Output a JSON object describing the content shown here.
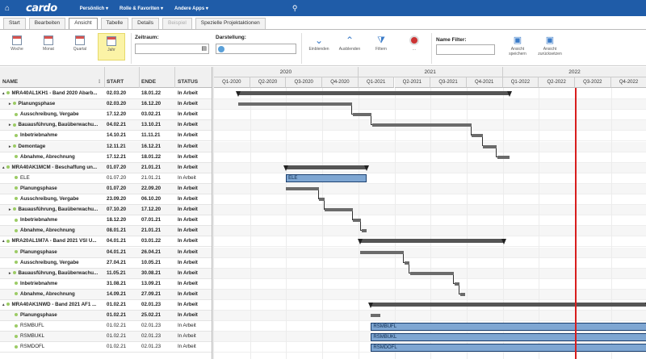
{
  "topbar": {
    "logo": "cardo",
    "menus": [
      "Persönlich",
      "Rolle & Favoriten",
      "Andere Apps"
    ]
  },
  "tabs": [
    {
      "label": "Start",
      "state": "normal"
    },
    {
      "label": "Bearbeiten",
      "state": "normal"
    },
    {
      "label": "Ansicht",
      "state": "active"
    },
    {
      "label": "Tabelle",
      "state": "normal"
    },
    {
      "label": "Details",
      "state": "normal"
    },
    {
      "label": "Beispiel",
      "state": "disabled"
    },
    {
      "label": "Spezielle Projektaktionen",
      "state": "normal"
    }
  ],
  "ribbon": {
    "view_buttons": [
      "Woche",
      "Monat",
      "Quartal",
      "Jahr"
    ],
    "selected_view": "Jahr",
    "zeitraum_label": "Zeitraum:",
    "darstellung_label": "Darstellung:",
    "action_buttons": [
      "Einblenden",
      "Ausblenden",
      "Filtern",
      "..."
    ],
    "name_filter_label": "Name Filter:",
    "save_view": "Ansicht speichern",
    "reset_view": "Ansicht zurücksetzen"
  },
  "columns": {
    "name": "NAME",
    "start": "START",
    "end": "ENDE",
    "status": "STATUS"
  },
  "timeline": {
    "years": [
      "2020",
      "2021",
      "2022"
    ],
    "quarters": [
      "Q1-2020",
      "Q2-2020",
      "Q3-2020",
      "Q4-2020",
      "Q1-2021",
      "Q2-2021",
      "Q3-2021",
      "Q4-2021",
      "Q1-2022",
      "Q2-2022",
      "Q3-2022",
      "Q4-2022",
      "Q"
    ]
  },
  "rows": [
    {
      "level": 0,
      "tri": "▴",
      "name": "MRA40AL1KH1 - Band 2020 Abarb...",
      "start": "02.03.20",
      "end": "18.01.22",
      "status": "In Arbeit",
      "bold": true,
      "bar": "sum"
    },
    {
      "level": 1,
      "tri": "▸",
      "name": "Planungsphase",
      "start": "02.03.20",
      "end": "16.12.20",
      "status": "In Arbeit",
      "bold": true,
      "bar": "task"
    },
    {
      "level": 1,
      "tri": "",
      "name": "Ausschreibung, Vergabe",
      "start": "17.12.20",
      "end": "03.02.21",
      "status": "In Arbeit",
      "bold": true,
      "bar": "task"
    },
    {
      "level": 1,
      "tri": "▸",
      "name": "Bauausführung, Bauüberwachu...",
      "start": "04.02.21",
      "end": "13.10.21",
      "status": "In Arbeit",
      "bold": true,
      "bar": "task"
    },
    {
      "level": 1,
      "tri": "",
      "name": "Inbetriebnahme",
      "start": "14.10.21",
      "end": "11.11.21",
      "status": "In Arbeit",
      "bold": true,
      "bar": "task"
    },
    {
      "level": 1,
      "tri": "▸",
      "name": "Demontage",
      "start": "12.11.21",
      "end": "16.12.21",
      "status": "In Arbeit",
      "bold": true,
      "bar": "task"
    },
    {
      "level": 1,
      "tri": "",
      "name": "Abnahme, Abrechnung",
      "start": "17.12.21",
      "end": "18.01.22",
      "status": "In Arbeit",
      "bold": true,
      "bar": "task"
    },
    {
      "level": 0,
      "tri": "▴",
      "name": "MRA40AK1MCM - Beschaffung un...",
      "start": "01.07.20",
      "end": "21.01.21",
      "status": "In Arbeit",
      "bold": true,
      "bar": "sum"
    },
    {
      "level": 1,
      "tri": "",
      "name": "ELE",
      "start": "01.07.20",
      "end": "21.01.21",
      "status": "In Arbeit",
      "bold": false,
      "bar": "blue",
      "bar_label": "ELE"
    },
    {
      "level": 1,
      "tri": "",
      "name": "Planungsphase",
      "start": "01.07.20",
      "end": "22.09.20",
      "status": "In Arbeit",
      "bold": true,
      "bar": "task"
    },
    {
      "level": 1,
      "tri": "",
      "name": "Ausschreibung, Vergabe",
      "start": "23.09.20",
      "end": "06.10.20",
      "status": "In Arbeit",
      "bold": true,
      "bar": "task"
    },
    {
      "level": 1,
      "tri": "▸",
      "name": "Bauausführung, Bauüberwachu...",
      "start": "07.10.20",
      "end": "17.12.20",
      "status": "In Arbeit",
      "bold": true,
      "bar": "task"
    },
    {
      "level": 1,
      "tri": "",
      "name": "Inbetriebnahme",
      "start": "18.12.20",
      "end": "07.01.21",
      "status": "In Arbeit",
      "bold": true,
      "bar": "task"
    },
    {
      "level": 1,
      "tri": "",
      "name": "Abnahme, Abrechnung",
      "start": "08.01.21",
      "end": "21.01.21",
      "status": "In Arbeit",
      "bold": true,
      "bar": "task"
    },
    {
      "level": 0,
      "tri": "▴",
      "name": "MRA20AL1M7A - Band 2021 VSI U...",
      "start": "04.01.21",
      "end": "03.01.22",
      "status": "In Arbeit",
      "bold": true,
      "bar": "sum"
    },
    {
      "level": 1,
      "tri": "",
      "name": "Planungsphase",
      "start": "04.01.21",
      "end": "26.04.21",
      "status": "In Arbeit",
      "bold": true,
      "bar": "task"
    },
    {
      "level": 1,
      "tri": "",
      "name": "Ausschreibung, Vergabe",
      "start": "27.04.21",
      "end": "10.05.21",
      "status": "In Arbeit",
      "bold": true,
      "bar": "task"
    },
    {
      "level": 1,
      "tri": "▸",
      "name": "Bauausführung, Bauüberwachu...",
      "start": "11.05.21",
      "end": "30.08.21",
      "status": "In Arbeit",
      "bold": true,
      "bar": "task"
    },
    {
      "level": 1,
      "tri": "",
      "name": "Inbetriebnahme",
      "start": "31.08.21",
      "end": "13.09.21",
      "status": "In Arbeit",
      "bold": true,
      "bar": "task"
    },
    {
      "level": 1,
      "tri": "",
      "name": "Abnahme, Abrechnung",
      "start": "14.09.21",
      "end": "27.09.21",
      "status": "In Arbeit",
      "bold": true,
      "bar": "task"
    },
    {
      "level": 0,
      "tri": "▴",
      "name": "MRA40AK1NWD - Band 2021 AF1 ...",
      "start": "01.02.21",
      "end": "02.01.23",
      "status": "In Arbeit",
      "bold": true,
      "bar": "sum"
    },
    {
      "level": 1,
      "tri": "",
      "name": "Planungsphase",
      "start": "01.02.21",
      "end": "25.02.21",
      "status": "In Arbeit",
      "bold": true,
      "bar": "task"
    },
    {
      "level": 1,
      "tri": "",
      "name": "RSMBUFL",
      "start": "01.02.21",
      "end": "02.01.23",
      "status": "In Arbeit",
      "bold": false,
      "bar": "blue",
      "bar_label": "RSMBUFL"
    },
    {
      "level": 1,
      "tri": "",
      "name": "RSMBUKL",
      "start": "01.02.21",
      "end": "02.01.23",
      "status": "In Arbeit",
      "bold": false,
      "bar": "blue",
      "bar_label": "RSMBUKL"
    },
    {
      "level": 1,
      "tri": "",
      "name": "RSMDOFL",
      "start": "01.02.21",
      "end": "02.01.23",
      "status": "In Arbeit",
      "bold": false,
      "bar": "blue",
      "bar_label": "RSMDOFL"
    }
  ],
  "today": "2022-07-01",
  "colors": {
    "topbar": "#1f5ca8",
    "today_line": "#d81e1e",
    "blue_bar": "#7ea6d2",
    "summary_bar": "#555555"
  }
}
